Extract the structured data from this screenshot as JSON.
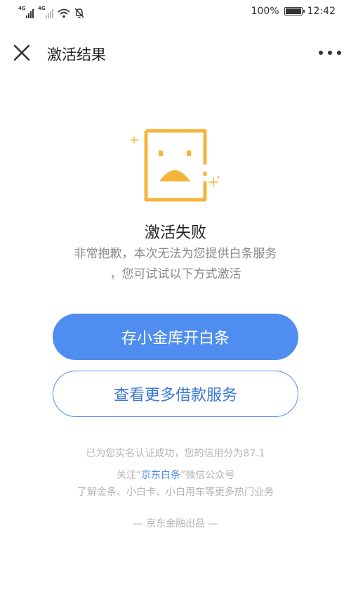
{
  "status_bar": {
    "signal1_label": "4G",
    "signal2_label": "4G",
    "battery_percent": "100%",
    "time": "12:42"
  },
  "header": {
    "title": "激活结果",
    "close_icon": "close-icon",
    "more_icon": "more-icon"
  },
  "result": {
    "title": "激活失败",
    "desc_line1": "非常抱歉，本次无法为您提供白条服务",
    "desc_line2": "，您可试试以下方式激活"
  },
  "actions": {
    "primary_label": "存小金库开白条",
    "secondary_label": "查看更多借款服务"
  },
  "footer": {
    "credit_line": "已为您实名认证成功，您的信用分为87.1",
    "follow_prefix": "关注“",
    "follow_link": "京东白条",
    "follow_suffix": "”微信公众号",
    "learn_more": "了解金条、小白卡、小白用车等更多热门业务",
    "brand": "— 京东金融出品 —"
  },
  "colors": {
    "accent": "#4f8ef0",
    "illustration": "#f5b53b"
  }
}
